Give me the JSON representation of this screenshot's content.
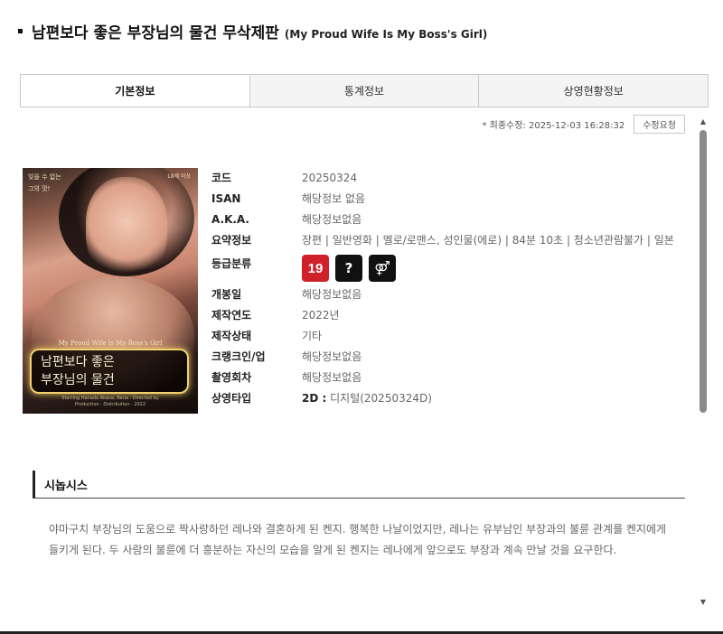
{
  "page": {
    "title": "남편보다 좋은 부장님의 물건 무삭제판",
    "title_en": "(My Proud Wife Is My Boss's Girl)"
  },
  "tabs": [
    {
      "label": "기본정보",
      "active": true
    },
    {
      "label": "통계정보",
      "active": false
    },
    {
      "label": "상영현황정보",
      "active": false
    }
  ],
  "meta": {
    "last_modified": "* 최종수정: 2025-12-03 16:28:32",
    "edit_button": "수정요청"
  },
  "poster": {
    "tag_left_1": "잊을 수 없는",
    "tag_left_2": "그의 맛!",
    "tag_right": "18세 이상",
    "subtitle_en": "My Proud Wife Is My Boss's Girl",
    "title_line1": "남편보다 좋은",
    "title_line2": "부장님의 물건",
    "credits_1": "Starring Hanada Akane, Rena · Directed by",
    "credits_2": "Production · Distribution · 2022"
  },
  "info": {
    "code": {
      "label": "코드",
      "value": "20250324"
    },
    "isan": {
      "label": "ISAN",
      "value": "해당정보 없음"
    },
    "aka": {
      "label": "A.K.A.",
      "value": "해당정보없음"
    },
    "summary": {
      "label": "요약정보",
      "value": "장편 | 일반영화 | 멜로/로맨스, 성인물(에로) | 84분 10초 | 청소년관람불가 | 일본"
    },
    "rating": {
      "label": "등급분류",
      "icons": [
        {
          "name": "rating-19-icon",
          "glyph": "19",
          "color": "#d0202a"
        },
        {
          "name": "theme-question-icon",
          "glyph": "?",
          "color": "#111111"
        },
        {
          "name": "sexuality-icon",
          "glyph": "⚤",
          "color": "#111111"
        }
      ]
    },
    "release": {
      "label": "개봉일",
      "value": "해당정보없음"
    },
    "year": {
      "label": "제작연도",
      "value": "2022년"
    },
    "status": {
      "label": "제작상태",
      "value": "기타"
    },
    "crank": {
      "label": "크랭크인/업",
      "value": "해당정보없음"
    },
    "shoot_count": {
      "label": "촬영회차",
      "value": "해당정보없음"
    },
    "screen_type": {
      "label": "상영타입",
      "type_key": "2D :",
      "value": " 디지털(20250324D)"
    }
  },
  "synopsis": {
    "title": "시놉시스",
    "text": "야마구치 부장님의 도움으로 짝사랑하던 레나와 결혼하게 된 켄지. 행복한 나날이었지만, 레나는 유부남인 부장과의 불륜 관계를 켄지에게 들키게 된다. 두 사람의 불륜에 더 흥분하는 자신의 모습을 알게 된 켄지는 레나에게 앞으로도 부장과 계속 만날 것을 요구한다."
  }
}
